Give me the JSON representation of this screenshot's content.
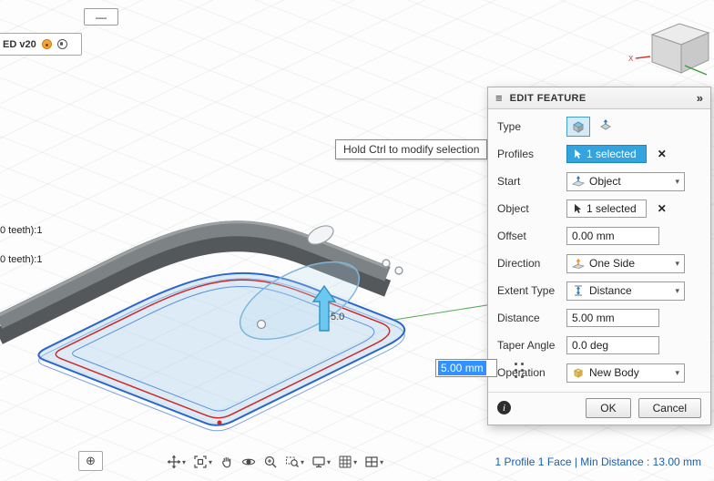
{
  "colors": {
    "accent_blue": "#35a3de",
    "selection_text_blue": "#3390ff",
    "status_blue": "#1b5fae",
    "profile_outline_blue": "#2b66cc",
    "profile_outline_red": "#cc2a2a",
    "body_grey": "#7d8385"
  },
  "icons": {
    "collapse": "—",
    "expand_plus": "⊕",
    "close": "✕",
    "caret": "▾",
    "chevrons": "»",
    "grip": "≡",
    "info": "i"
  },
  "top_left": {
    "doc_label": "ED v20"
  },
  "browser_items": [
    "0 teeth):1",
    "0 teeth):1"
  ],
  "canvas": {
    "tooltip": "Hold Ctrl to modify selection",
    "manipulator_label": "5.0",
    "distance_value": "5.00 mm"
  },
  "dialog": {
    "title": "EDIT FEATURE",
    "type": {
      "label": "Type"
    },
    "profiles": {
      "label": "Profiles",
      "value": "1 selected"
    },
    "start": {
      "label": "Start",
      "value": "Object"
    },
    "object": {
      "label": "Object",
      "value": "1 selected"
    },
    "offset": {
      "label": "Offset",
      "value": "0.00 mm"
    },
    "direction": {
      "label": "Direction",
      "value": "One Side"
    },
    "extent_type": {
      "label": "Extent Type",
      "value": "Distance"
    },
    "distance": {
      "label": "Distance",
      "value": "5.00 mm"
    },
    "taper_angle": {
      "label": "Taper Angle",
      "value": "0.0 deg"
    },
    "operation": {
      "label": "Operation",
      "value": "New Body"
    },
    "ok": "OK",
    "cancel": "Cancel"
  },
  "viewcube": {
    "x_label": "X"
  },
  "status": {
    "text": "1 Profile 1 Face | Min Distance : 13.00 mm"
  }
}
